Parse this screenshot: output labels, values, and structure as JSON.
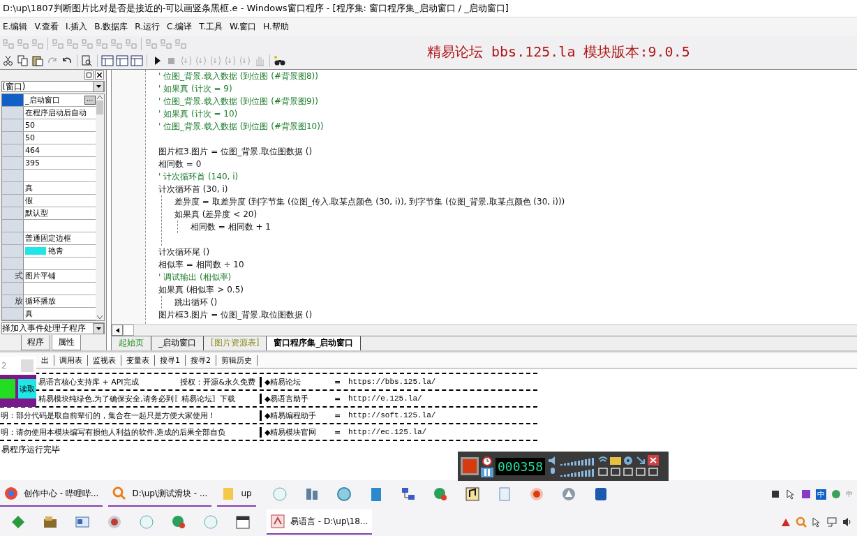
{
  "window": {
    "title": "D:\\up\\1807判断图片比对是否是接近的-可以画竖条黑框.e - Windows窗口程序 - [程序集: 窗口程序集_启动窗口 / _启动窗口]"
  },
  "menu": [
    "E.编辑",
    "V.查看",
    "I.插入",
    "B.数据库",
    "R.运行",
    "C.编译",
    "T.工具",
    "W.窗口",
    "H.帮助"
  ],
  "banner": "精易论坛 bbs.125.la 模块版本:9.0.5",
  "properties": {
    "object": "(窗口)",
    "rows": [
      {
        "value": "_启动窗口",
        "ellipsis": "⋯",
        "selected": true
      },
      {
        "value": "在程序启动后自动",
        "selected": false
      },
      {
        "value": "50",
        "selected": false
      },
      {
        "value": "50",
        "selected": false
      },
      {
        "value": "464",
        "selected": false
      },
      {
        "value": "395",
        "selected": false
      },
      {
        "selected": false
      },
      {
        "value": "真",
        "selected": false
      },
      {
        "value": "假",
        "selected": false
      },
      {
        "value": "默认型",
        "selected": false
      },
      {
        "selected": false
      },
      {
        "value": "普通固定边框",
        "selected": false
      },
      {
        "value": "艳青",
        "color": "#22e6e6",
        "selected": false
      },
      {
        "selected": false
      },
      {
        "name": "式",
        "value": "图片平铺",
        "selected": false
      },
      {
        "selected": false
      },
      {
        "name": "放",
        "value": "循环播放",
        "selected": false
      },
      {
        "value": "真",
        "selected": false
      }
    ],
    "event": "择加入事件处理子程序",
    "tabs": [
      {
        "label": "程序",
        "selected": false
      },
      {
        "label": "属性",
        "selected": true
      }
    ]
  },
  "code_blocks": [
    [
      {
        "kind": "comment",
        "text": "' 位图_背景.载入数据 (到位图 (#背景图8))"
      },
      {
        "kind": "comment",
        "text": "' 如果真 (计次 = 9)"
      },
      {
        "kind": "comment",
        "text": "' 位图_背景.载入数据 (到位图 (#背景图9))"
      },
      {
        "kind": "comment",
        "text": "' 如果真 (计次 = 10)"
      },
      {
        "kind": "comment",
        "text": "' 位图_背景.载入数据 (到位图 (#背景图10))"
      }
    ],
    [
      {
        "kind": "code",
        "text": "图片框3.图片 = 位图_背景.取位图数据 ()"
      },
      {
        "kind": "code",
        "text": "相同数 = 0"
      },
      {
        "kind": "comment",
        "text": "' 计次循环首 (140, i)"
      },
      {
        "kind": "loop",
        "text": "计次循环首 (30, i)",
        "end": "计次循环尾 ()",
        "children": [
          {
            "kind": "code",
            "text": "差异度 = 取差异度 (到字节集 (位图_传入.取某点颜色 (30, i)), 到字节集 (位图_背景.取某点颜色 (30, i)))"
          },
          {
            "kind": "if",
            "text": "如果真 (差异度 < 20)",
            "children": [
              {
                "kind": "code",
                "text": "相同数 = 相同数 + 1"
              }
            ]
          }
        ]
      },
      {
        "kind": "code",
        "text": "相似率 = 相同数 ÷ 10"
      },
      {
        "kind": "comment",
        "text": "' 调试输出 (相似率)"
      },
      {
        "kind": "if",
        "text": "如果真 (相似率 > 0.5)",
        "children": [
          {
            "kind": "code",
            "text": "跳出循环 ()"
          }
        ]
      },
      {
        "kind": "code",
        "text": "图片框3.图片 = 位图_背景.取位图数据 ()"
      }
    ]
  ],
  "editor_tabs": [
    {
      "label": "起始页",
      "kind": "start",
      "selected": false
    },
    {
      "label": "_启动窗口",
      "kind": "window",
      "selected": false
    },
    {
      "label": "[图片资源表]",
      "kind": "resource",
      "selected": false
    },
    {
      "label": "窗口程序集_启动窗口",
      "kind": "class",
      "selected": true
    }
  ],
  "output_tabs": [
    "出",
    "调用表",
    "监视表",
    "变量表",
    "搜寻1",
    "搜寻2",
    "剪辑历史"
  ],
  "mini_window": {
    "field": "2",
    "button": "读取"
  },
  "output_rows": [
    {
      "message": "易语言核心支持库 + API完成",
      "extra": "授权：开源&永久免费",
      "site": "◆精易论坛",
      "eq": "=",
      "url": "https://bbs.125.la/"
    },
    {
      "message": "精易模块纯绿色,为了确保安全,请务必到〖精易论坛〗下载",
      "site": "◆易语言助手",
      "eq": "=",
      "url": "http://e.125.la/"
    },
    {
      "message": "明：部分代码是取自前辈们的，集合在一起只是方便大家使用！",
      "site": "◆精易编程助手",
      "eq": "=",
      "url": "http://soft.125.la/"
    },
    {
      "message": "明：请勿使用本模块编写有损他人利益的软件,造成的后果全部自负",
      "site": "◆精易模块官网",
      "eq": "=",
      "url": "http://ec.125.la/"
    }
  ],
  "output_status": "易程序运行完毕",
  "recorder": {
    "time": "000358"
  },
  "taskbar": {
    "row1": [
      {
        "label": "创作中心 - 哔哩哔...",
        "running": true
      },
      {
        "label": "D:\\up\\测试滑块 - ...",
        "running": true
      },
      {
        "label": "up",
        "running": true
      }
    ],
    "row2": [
      {
        "label": "易语言 - D:\\up\\18...",
        "running": true
      }
    ],
    "ime": "中",
    "ime_small": "中"
  }
}
